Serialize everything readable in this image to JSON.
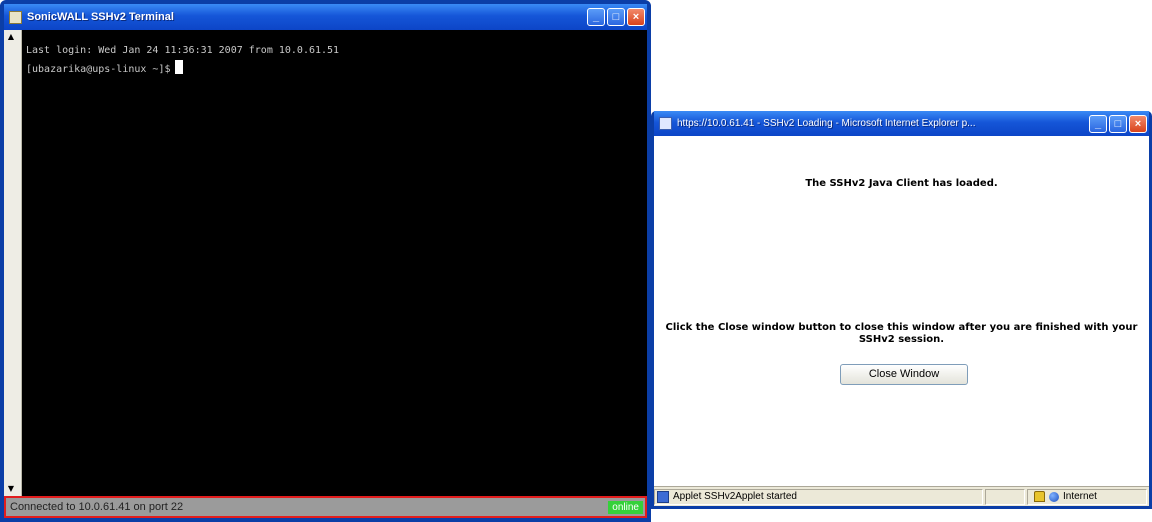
{
  "terminal": {
    "title": "SonicWALL SSHv2 Terminal",
    "lines": [
      "Last login: Wed Jan 24 11:36:31 2007 from 10.0.61.51",
      "[ubazarika@ups-linux ~]$"
    ],
    "status_text": "Connected to 10.0.61.41 on port 22",
    "status_badge": "online",
    "colors": {
      "background": "#000000",
      "status_border": "#e21d1d",
      "badge": "#35d13a"
    }
  },
  "ie_window": {
    "title": "https://10.0.61.41 - SSHv2 Loading - Microsoft Internet Explorer p...",
    "message_loaded": "The SSHv2 Java Client has loaded.",
    "instructions": "Click the Close window button to close this window after you are finished with your SSHv2 session.",
    "close_button": "Close Window",
    "status_text": "Applet SSHv2Applet started",
    "zone": "Internet"
  },
  "window_controls": {
    "minimize": "_",
    "maximize": "□",
    "close": "×"
  }
}
